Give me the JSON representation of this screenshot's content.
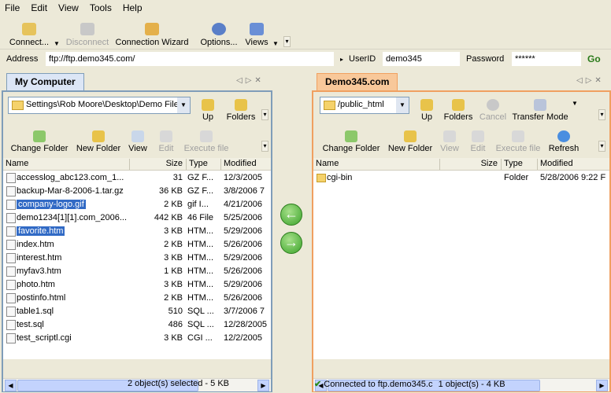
{
  "menu": [
    "File",
    "Edit",
    "View",
    "Tools",
    "Help"
  ],
  "toolbar": {
    "connect": "Connect...",
    "disconnect": "Disconnect",
    "wizard": "Connection Wizard",
    "options": "Options...",
    "views": "Views"
  },
  "address": {
    "label": "Address",
    "value": "ftp://ftp.demo345.com/",
    "userid_label": "UserID",
    "userid_value": "demo345",
    "password_label": "Password",
    "password_value": "******",
    "go": "Go"
  },
  "left": {
    "tab": "My Computer",
    "path": "Settings\\Rob Moore\\Desktop\\Demo Files",
    "buttons": {
      "up": "Up",
      "folders": "Folders",
      "change_folder": "Change Folder",
      "new_folder": "New Folder",
      "view": "View",
      "edit": "Edit",
      "execute": "Execute file"
    },
    "columns": [
      "Name",
      "Size",
      "Type",
      "Modified"
    ],
    "rows": [
      {
        "name": "accesslog_abc123.com_1...",
        "size": "31",
        "type": "GZ F...",
        "modified": "12/3/2005"
      },
      {
        "name": "backup-Mar-8-2006-1.tar.gz",
        "size": "36 KB",
        "type": "GZ F...",
        "modified": "3/8/2006 7"
      },
      {
        "name": "company-logo.gif",
        "size": "2 KB",
        "type": "gif I...",
        "modified": "4/21/2006"
      },
      {
        "name": "demo1234[1][1].com_2006...",
        "size": "442 KB",
        "type": "46 File",
        "modified": "5/25/2006"
      },
      {
        "name": "favorite.htm",
        "size": "3 KB",
        "type": "HTM...",
        "modified": "5/29/2006"
      },
      {
        "name": "index.htm",
        "size": "2 KB",
        "type": "HTM...",
        "modified": "5/26/2006"
      },
      {
        "name": "interest.htm",
        "size": "3 KB",
        "type": "HTM...",
        "modified": "5/29/2006"
      },
      {
        "name": "myfav3.htm",
        "size": "1 KB",
        "type": "HTM...",
        "modified": "5/26/2006"
      },
      {
        "name": "photo.htm",
        "size": "3 KB",
        "type": "HTM...",
        "modified": "5/29/2006"
      },
      {
        "name": "postinfo.html",
        "size": "2 KB",
        "type": "HTM...",
        "modified": "5/26/2006"
      },
      {
        "name": "table1.sql",
        "size": "510",
        "type": "SQL ...",
        "modified": "3/7/2006 7"
      },
      {
        "name": "test.sql",
        "size": "486",
        "type": "SQL ...",
        "modified": "12/28/2005"
      },
      {
        "name": "test_scriptl.cgi",
        "size": "3 KB",
        "type": "CGI ...",
        "modified": "12/2/2005"
      }
    ],
    "status": "2 object(s) selected - 5 KB"
  },
  "right": {
    "tab": "Demo345.com",
    "path": "/public_html",
    "buttons": {
      "up": "Up",
      "folders": "Folders",
      "cancel": "Cancel",
      "transfer_mode": "Transfer Mode",
      "change_folder": "Change Folder",
      "new_folder": "New Folder",
      "view": "View",
      "edit": "Edit",
      "execute": "Execute file",
      "refresh": "Refresh"
    },
    "columns": [
      "Name",
      "Size",
      "Type",
      "Modified"
    ],
    "rows": [
      {
        "name": "cgi-bin",
        "size": "",
        "type": "Folder",
        "modified": "5/28/2006 9:22 F"
      }
    ],
    "status_conn": "Connected to ftp.demo345.c",
    "status_count": "1 object(s) - 4 KB"
  },
  "colors": {
    "left_border": "#7f9db9",
    "right_border": "#f0a060",
    "selection": "#316ac5"
  }
}
